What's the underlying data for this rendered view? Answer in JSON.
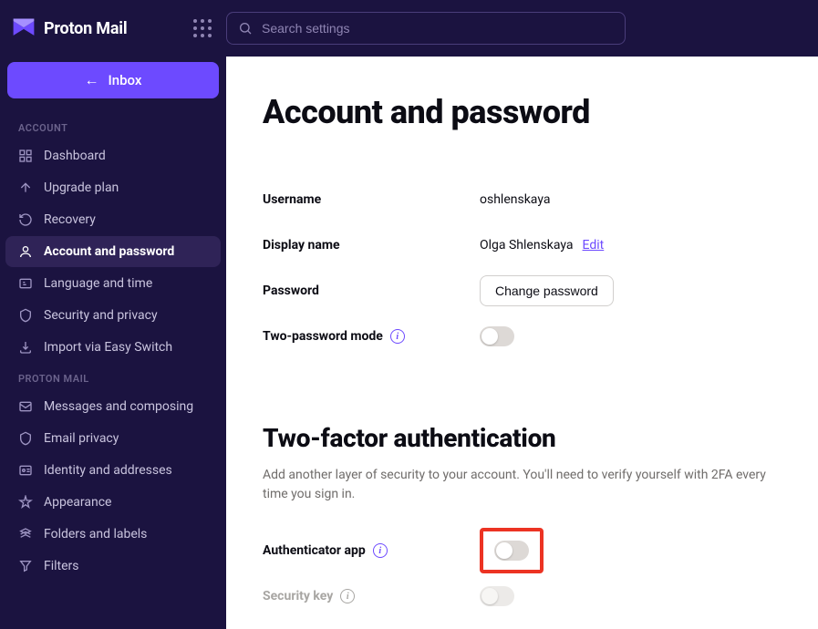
{
  "app_name": "Proton Mail",
  "search": {
    "placeholder": "Search settings"
  },
  "inbox_button": "Inbox",
  "sections": {
    "account_label": "ACCOUNT",
    "proton_mail_label": "PROTON MAIL"
  },
  "nav_account": [
    {
      "icon": "dashboard-icon",
      "label": "Dashboard"
    },
    {
      "icon": "upgrade-icon",
      "label": "Upgrade plan"
    },
    {
      "icon": "recovery-icon",
      "label": "Recovery"
    },
    {
      "icon": "account-icon",
      "label": "Account and password",
      "active": true
    },
    {
      "icon": "language-icon",
      "label": "Language and time"
    },
    {
      "icon": "shield-icon",
      "label": "Security and privacy"
    },
    {
      "icon": "import-icon",
      "label": "Import via Easy Switch"
    }
  ],
  "nav_mail": [
    {
      "icon": "messages-icon",
      "label": "Messages and composing"
    },
    {
      "icon": "privacy-icon",
      "label": "Email privacy"
    },
    {
      "icon": "identity-icon",
      "label": "Identity and addresses"
    },
    {
      "icon": "appearance-icon",
      "label": "Appearance"
    },
    {
      "icon": "folders-icon",
      "label": "Folders and labels"
    },
    {
      "icon": "filters-icon",
      "label": "Filters"
    }
  ],
  "main": {
    "title": "Account and password",
    "username_label": "Username",
    "username_value": "oshlenskaya",
    "displayname_label": "Display name",
    "displayname_value": "Olga Shlenskaya",
    "edit_label": "Edit",
    "password_label": "Password",
    "change_password_label": "Change password",
    "two_password_label": "Two-password mode",
    "tfa_heading": "Two-factor authentication",
    "tfa_desc": "Add another layer of security to your account. You'll need to verify yourself with 2FA every time you sign in.",
    "authenticator_label": "Authenticator app",
    "security_key_label": "Security key"
  }
}
